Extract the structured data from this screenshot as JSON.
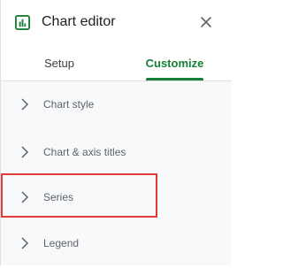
{
  "header": {
    "title": "Chart editor",
    "logo_icon": "chart-icon",
    "close_icon": "close-icon"
  },
  "tabs": [
    {
      "label": "Setup",
      "active": false
    },
    {
      "label": "Customize",
      "active": true
    }
  ],
  "sections": [
    {
      "label": "Chart style",
      "icon": "chevron-right-icon"
    },
    {
      "label": "Chart & axis titles",
      "icon": "chevron-right-icon"
    },
    {
      "label": "Series",
      "icon": "chevron-right-icon",
      "highlighted": true
    },
    {
      "label": "Legend",
      "icon": "chevron-right-icon"
    }
  ],
  "colors": {
    "accent": "#188038",
    "highlight": "#e53935",
    "section_bg": "#f8f9fa"
  }
}
